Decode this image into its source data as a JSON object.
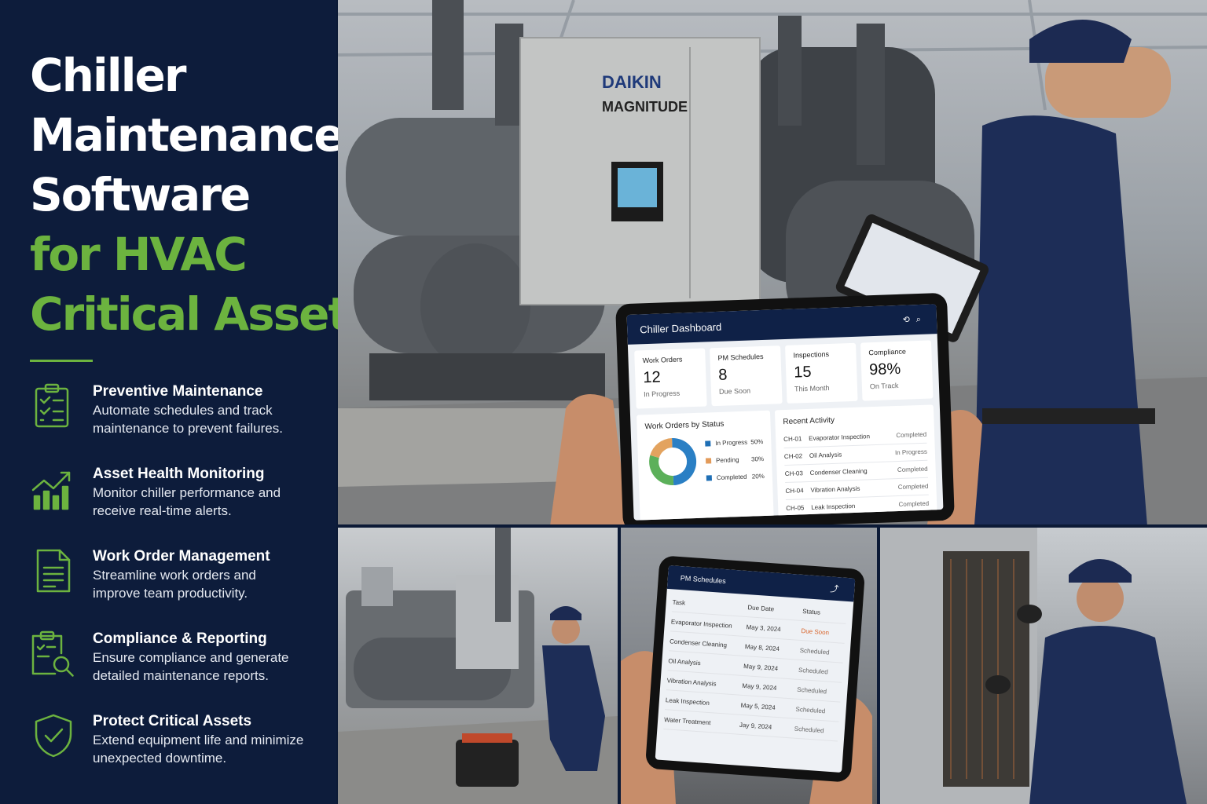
{
  "headline": {
    "line1": "Chiller",
    "line2": "Maintenance",
    "line3": "Software",
    "line4": "for HVAC",
    "line5": "Critical Assets"
  },
  "colors": {
    "navy": "#0d1c3b",
    "green": "#6cb33f",
    "dash_header": "#0f2147",
    "due_soon": "#d9642a"
  },
  "features": [
    {
      "icon": "clipboard-checklist-icon",
      "title": "Preventive Maintenance",
      "desc": "Automate schedules and track maintenance to prevent failures."
    },
    {
      "icon": "trend-chart-icon",
      "title": "Asset Health Monitoring",
      "desc": "Monitor chiller performance and receive real-time alerts."
    },
    {
      "icon": "document-icon",
      "title": "Work Order Management",
      "desc": "Streamline work orders and improve team productivity."
    },
    {
      "icon": "clipboard-search-icon",
      "title": "Compliance & Reporting",
      "desc": "Ensure compliance and generate detailed maintenance reports."
    },
    {
      "icon": "shield-check-icon",
      "title": "Protect Critical Assets",
      "desc": "Extend equipment life and minimize unexpected downtime."
    }
  ],
  "equipment": {
    "brand": "DAIKIN",
    "model": "MAGNITUDE"
  },
  "dashboard": {
    "title": "Chiller Dashboard",
    "cards": [
      {
        "label": "Work Orders",
        "value": "12",
        "sub": "In Progress"
      },
      {
        "label": "PM Schedules",
        "value": "8",
        "sub": "Due Soon"
      },
      {
        "label": "Inspections",
        "value": "15",
        "sub": "This Month"
      },
      {
        "label": "Compliance",
        "value": "98%",
        "sub": "On Track"
      }
    ],
    "status_title": "Work Orders by Status",
    "status": [
      {
        "label": "In Progress",
        "pct": "50%",
        "value": 50,
        "color": "#1f6fb5"
      },
      {
        "label": "Pending",
        "pct": "30%",
        "value": 30,
        "color": "#e39b5a"
      },
      {
        "label": "Completed",
        "pct": "20%",
        "value": 20,
        "color": "#1f6fb5"
      }
    ],
    "donut_colors": [
      "#2a7fc4",
      "#5cb05a",
      "#e3a35f"
    ],
    "activity_title": "Recent Activity",
    "activity": [
      {
        "id": "CH-01",
        "task": "Evaporator Inspection",
        "status": "Completed"
      },
      {
        "id": "CH-02",
        "task": "Oil Analysis",
        "status": "In Progress"
      },
      {
        "id": "CH-03",
        "task": "Condenser Cleaning",
        "status": "Completed"
      },
      {
        "id": "CH-04",
        "task": "Vibration Analysis",
        "status": "Completed"
      },
      {
        "id": "CH-05",
        "task": "Leak Inspection",
        "status": "Completed"
      }
    ]
  },
  "pm": {
    "title": "PM Schedules",
    "headers": {
      "task": "Task",
      "due": "Due Date",
      "status": "Status"
    },
    "rows": [
      {
        "task": "Evaporator Inspection",
        "due": "May 3, 2024",
        "status": "Due Soon"
      },
      {
        "task": "Condenser Cleaning",
        "due": "May 8, 2024",
        "status": "Scheduled"
      },
      {
        "task": "Oil Analysis",
        "due": "May 9, 2024",
        "status": "Scheduled"
      },
      {
        "task": "Vibration Analysis",
        "due": "May 9, 2024",
        "status": "Scheduled"
      },
      {
        "task": "Leak Inspection",
        "due": "May 5, 2024",
        "status": "Scheduled"
      },
      {
        "task": "Water Treatment",
        "due": "Jay 9, 2024",
        "status": "Scheduled"
      }
    ]
  }
}
